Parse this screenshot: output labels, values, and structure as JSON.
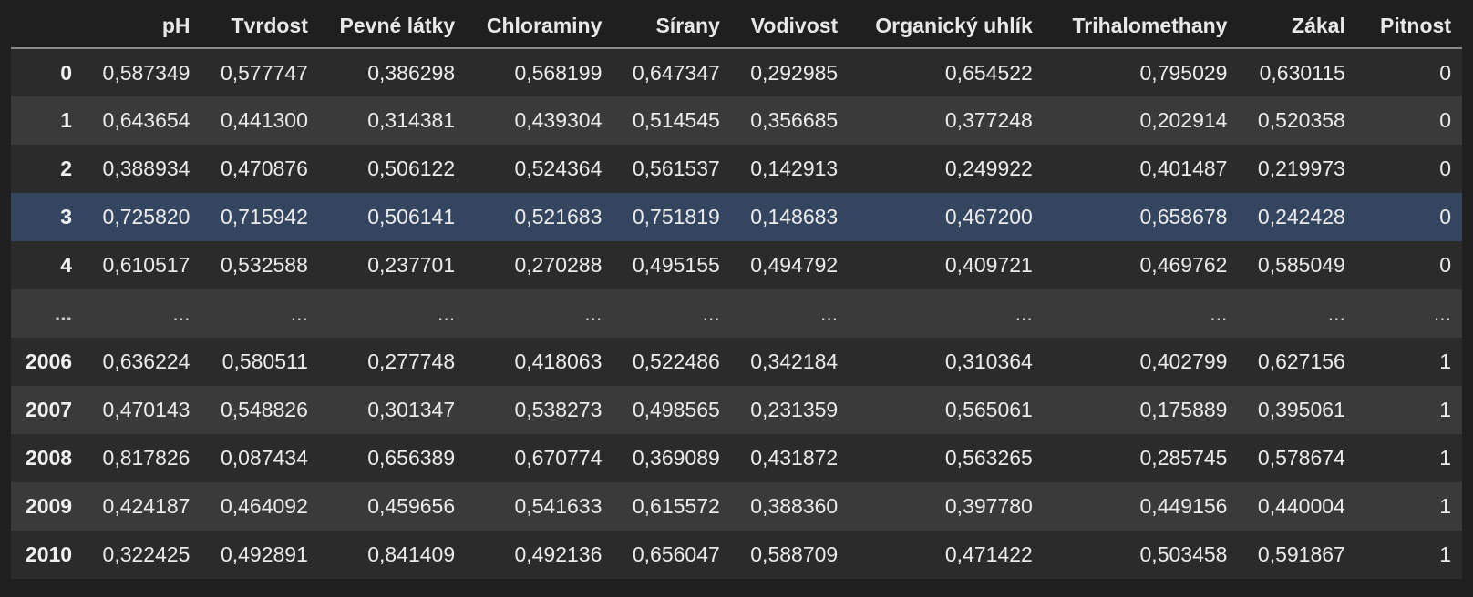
{
  "columns": [
    "",
    "pH",
    "Tvrdost",
    "Pevné látky",
    "Chloraminy",
    "Sírany",
    "Vodivost",
    "Organický uhlík",
    "Trihalomethany",
    "Zákal",
    "Pitnost"
  ],
  "rows": [
    {
      "index": "0",
      "values": [
        "0,587349",
        "0,577747",
        "0,386298",
        "0,568199",
        "0,647347",
        "0,292985",
        "0,654522",
        "0,795029",
        "0,630115",
        "0"
      ]
    },
    {
      "index": "1",
      "values": [
        "0,643654",
        "0,441300",
        "0,314381",
        "0,439304",
        "0,514545",
        "0,356685",
        "0,377248",
        "0,202914",
        "0,520358",
        "0"
      ]
    },
    {
      "index": "2",
      "values": [
        "0,388934",
        "0,470876",
        "0,506122",
        "0,524364",
        "0,561537",
        "0,142913",
        "0,249922",
        "0,401487",
        "0,219973",
        "0"
      ]
    },
    {
      "index": "3",
      "values": [
        "0,725820",
        "0,715942",
        "0,506141",
        "0,521683",
        "0,751819",
        "0,148683",
        "0,467200",
        "0,658678",
        "0,242428",
        "0"
      ]
    },
    {
      "index": "4",
      "values": [
        "0,610517",
        "0,532588",
        "0,237701",
        "0,270288",
        "0,495155",
        "0,494792",
        "0,409721",
        "0,469762",
        "0,585049",
        "0"
      ]
    },
    {
      "index": "...",
      "values": [
        "...",
        "...",
        "...",
        "...",
        "...",
        "...",
        "...",
        "...",
        "...",
        "..."
      ]
    },
    {
      "index": "2006",
      "values": [
        "0,636224",
        "0,580511",
        "0,277748",
        "0,418063",
        "0,522486",
        "0,342184",
        "0,310364",
        "0,402799",
        "0,627156",
        "1"
      ]
    },
    {
      "index": "2007",
      "values": [
        "0,470143",
        "0,548826",
        "0,301347",
        "0,538273",
        "0,498565",
        "0,231359",
        "0,565061",
        "0,175889",
        "0,395061",
        "1"
      ]
    },
    {
      "index": "2008",
      "values": [
        "0,817826",
        "0,087434",
        "0,656389",
        "0,670774",
        "0,369089",
        "0,431872",
        "0,563265",
        "0,285745",
        "0,578674",
        "1"
      ]
    },
    {
      "index": "2009",
      "values": [
        "0,424187",
        "0,464092",
        "0,459656",
        "0,541633",
        "0,615572",
        "0,388360",
        "0,397780",
        "0,449156",
        "0,440004",
        "1"
      ]
    },
    {
      "index": "2010",
      "values": [
        "0,322425",
        "0,492891",
        "0,841409",
        "0,492136",
        "0,656047",
        "0,588709",
        "0,471422",
        "0,503458",
        "0,591867",
        "1"
      ]
    }
  ],
  "selected_row": "3",
  "colors": {
    "background": "#1f1f1f",
    "row_odd": "#2b2b2b",
    "row_even": "#3a3a3a",
    "row_selected": "#344560"
  }
}
